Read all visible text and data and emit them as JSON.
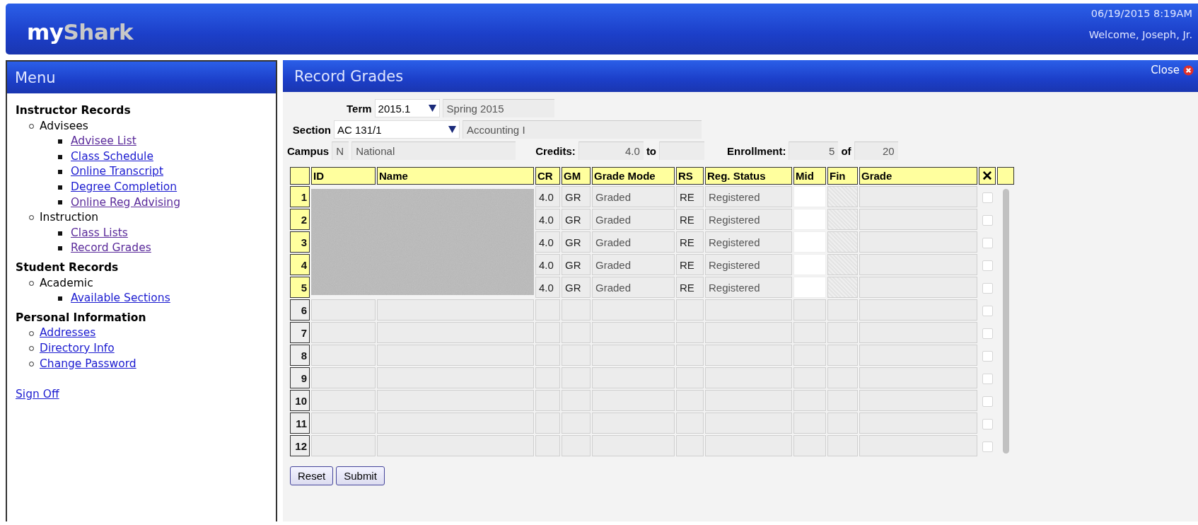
{
  "header": {
    "logo_primary": "my",
    "logo_secondary": "Shark",
    "datetime": "06/19/2015  8:19AM",
    "welcome": "Welcome, Joseph, Jr."
  },
  "menu": {
    "title": "Menu",
    "sections": [
      {
        "title": "Instructor Records",
        "children": [
          {
            "kind": "group",
            "label": "Advisees",
            "children": [
              {
                "label": "Advisee List",
                "visited": true
              },
              {
                "label": "Class Schedule",
                "visited": false
              },
              {
                "label": "Online Transcript",
                "visited": false
              },
              {
                "label": "Degree Completion",
                "visited": false
              },
              {
                "label": "Online Reg Advising",
                "visited": true
              }
            ]
          },
          {
            "kind": "group",
            "label": "Instruction",
            "children": [
              {
                "label": "Class Lists",
                "visited": true
              },
              {
                "label": "Record Grades",
                "visited": true
              }
            ]
          }
        ]
      },
      {
        "title": "Student Records",
        "children": [
          {
            "kind": "group",
            "label": "Academic",
            "children": [
              {
                "label": "Available Sections",
                "visited": false
              }
            ]
          }
        ]
      },
      {
        "title": "Personal Information",
        "children": [
          {
            "kind": "link",
            "label": "Addresses",
            "visited": false
          },
          {
            "kind": "link",
            "label": "Directory Info",
            "visited": false
          },
          {
            "kind": "link",
            "label": "Change Password",
            "visited": false
          }
        ]
      }
    ],
    "sign_off": "Sign Off"
  },
  "panel": {
    "title": "Record Grades",
    "close": "Close"
  },
  "form": {
    "term_label": "Term",
    "term": "2015.1",
    "term_name": "Spring 2015",
    "section_label": "Section",
    "section": "AC 131/1",
    "section_name": "Accounting I",
    "campus_label": "Campus",
    "campus_code": "N",
    "campus_name": "National",
    "credits_label": "Credits:",
    "credits": "4.0",
    "credits_to_label": "to",
    "enrollment_label": "Enrollment:",
    "enrolled": "5",
    "of_label": "of",
    "capacity": "20"
  },
  "table": {
    "columns": [
      "ID",
      "Name",
      "CR",
      "GM",
      "Grade Mode",
      "RS",
      "Reg. Status",
      "Mid",
      "Fin",
      "Grade",
      "✕"
    ],
    "rows": [
      {
        "kind": "student",
        "number": "1",
        "cr": "4.0",
        "gm": "GR",
        "grade_mode": "Graded",
        "rs": "RE",
        "reg_status": "Registered",
        "checked": false
      },
      {
        "kind": "student",
        "number": "2",
        "cr": "4.0",
        "gm": "GR",
        "grade_mode": "Graded",
        "rs": "RE",
        "reg_status": "Registered",
        "checked": false
      },
      {
        "kind": "student",
        "number": "3",
        "cr": "4.0",
        "gm": "GR",
        "grade_mode": "Graded",
        "rs": "RE",
        "reg_status": "Registered",
        "checked": false
      },
      {
        "kind": "student",
        "number": "4",
        "cr": "4.0",
        "gm": "GR",
        "grade_mode": "Graded",
        "rs": "RE",
        "reg_status": "Registered",
        "checked": false
      },
      {
        "kind": "student",
        "number": "5",
        "cr": "4.0",
        "gm": "GR",
        "grade_mode": "Graded",
        "rs": "RE",
        "reg_status": "Registered",
        "checked": false
      },
      {
        "kind": "empty",
        "number": "6",
        "checked": false
      },
      {
        "kind": "empty",
        "number": "7",
        "checked": false
      },
      {
        "kind": "empty",
        "number": "8",
        "checked": false
      },
      {
        "kind": "empty",
        "number": "9",
        "checked": false
      },
      {
        "kind": "empty",
        "number": "10",
        "checked": false
      },
      {
        "kind": "empty",
        "number": "11",
        "checked": false
      },
      {
        "kind": "empty",
        "number": "12",
        "checked": false
      }
    ]
  },
  "buttons": [
    "Reset",
    "Submit"
  ]
}
